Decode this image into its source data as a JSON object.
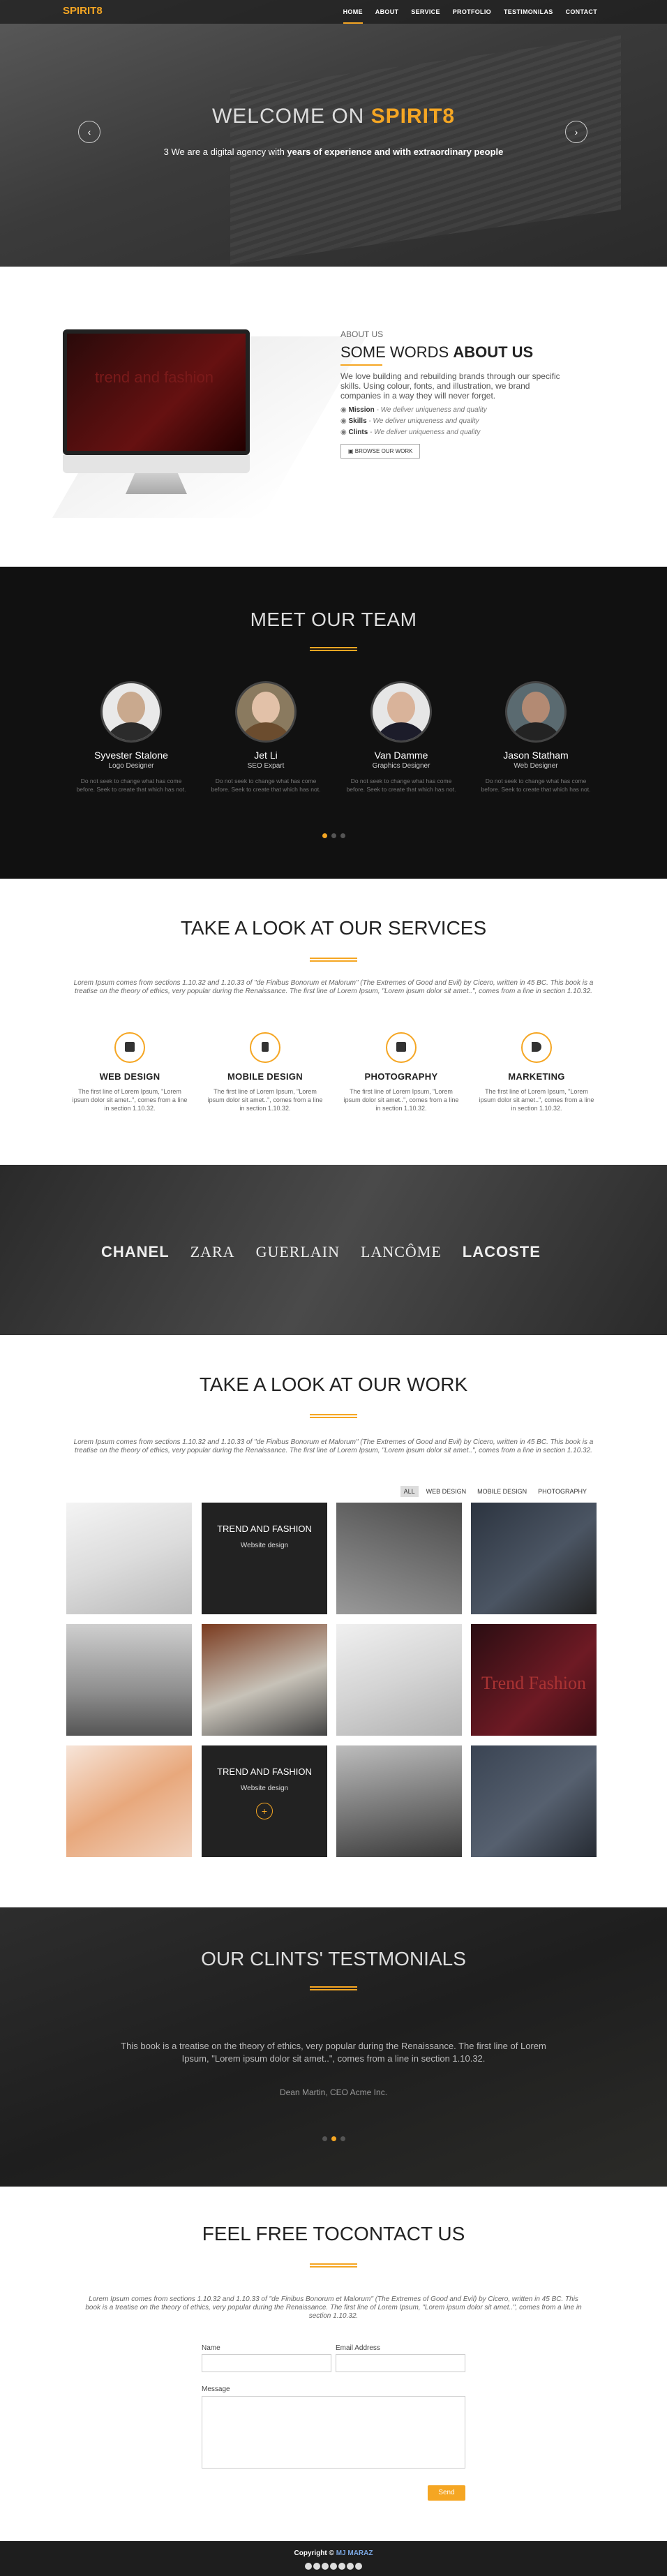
{
  "nav": {
    "logo": "SPIRIT8",
    "items": [
      "HOME",
      "ABOUT",
      "SERVICE",
      "PROTFOLIO",
      "TESTIMONILAS",
      "CONTACT"
    ],
    "active": "HOME"
  },
  "hero": {
    "title_prefix": "WELCOME ON ",
    "title_brand": "SPIRIT8",
    "subtitle_prefix": "3 We are a digital agency with ",
    "subtitle_bold": "years of experience and with extraordinary people",
    "prev": "‹",
    "next": "›"
  },
  "about": {
    "kicker": "ABOUT US",
    "title_prefix": "SOME WORDS ",
    "title_bold": "ABOUT US",
    "lead": "We love building and rebuilding brands through our specific skills. Using colour, fonts, and illustration, we brand companies in a way they will never forget.",
    "items": [
      {
        "name": "Mission",
        "desc": " - We deliver uniqueness and quality"
      },
      {
        "name": "Skills",
        "desc": " - We deliver uniqueness and quality"
      },
      {
        "name": "Clints",
        "desc": " - We deliver uniqueness and quality"
      }
    ],
    "button": "BROWSE OUR WORK",
    "screen_text": "trend and fashion"
  },
  "team": {
    "title": "MEET OUR TEAM",
    "members": [
      {
        "name": "Syvester Stalone",
        "role": "Logo Designer",
        "desc": "Do not seek to change what has come before. Seek to create that which has not."
      },
      {
        "name": "Jet Li",
        "role": "SEO Expart",
        "desc": "Do not seek to change what has come before. Seek to create that which has not."
      },
      {
        "name": "Van Damme",
        "role": "Graphics Designer",
        "desc": "Do not seek to change what has come before. Seek to create that which has not."
      },
      {
        "name": "Jason Statham",
        "role": "Web Designer",
        "desc": "Do not seek to change what has come before. Seek to create that which has not."
      }
    ]
  },
  "services": {
    "title": "TAKE A LOOK AT OUR SERVICES",
    "intro": "Lorem Ipsum comes from sections 1.10.32 and 1.10.33 of \"de Finibus Bonorum et Malorum\" (The Extremes of Good and Evil) by Cicero, written in 45 BC. This book is a treatise on the theory of ethics, very popular during the Renaissance. The first line of Lorem Ipsum, \"Lorem ipsum dolor sit amet..\", comes from a line in section 1.10.32.",
    "items": [
      {
        "title": "WEB DESIGN",
        "desc": "The first line of Lorem Ipsum, \"Lorem ipsum dolor sit amet..\", comes from a line in section 1.10.32.",
        "icon": "monitor-icon"
      },
      {
        "title": "MOBILE DESIGN",
        "desc": "The first line of Lorem Ipsum, \"Lorem ipsum dolor sit amet..\", comes from a line in section 1.10.32.",
        "icon": "mobile-icon"
      },
      {
        "title": "PHOTOGRAPHY",
        "desc": "The first line of Lorem Ipsum, \"Lorem ipsum dolor sit amet..\", comes from a line in section 1.10.32.",
        "icon": "camera-icon"
      },
      {
        "title": "MARKETING",
        "desc": "The first line of Lorem Ipsum, \"Lorem ipsum dolor sit amet..\", comes from a line in section 1.10.32.",
        "icon": "megaphone-icon"
      }
    ]
  },
  "brands": [
    "CHANEL",
    "ZARA",
    "GUERLAIN",
    "LANCÔME",
    "LACOSTE"
  ],
  "work": {
    "title": "TAKE A LOOK AT OUR WORK",
    "intro": "Lorem Ipsum comes from sections 1.10.32 and 1.10.33 of \"de Finibus Bonorum et Malorum\" (The Extremes of Good and Evil) by Cicero, written in 45 BC. This book is a treatise on the theory of ethics, very popular during the Renaissance. The first line of Lorem Ipsum, \"Lorem ipsum dolor sit amet..\", comes from a line in section 1.10.32.",
    "filters": [
      "ALL",
      "WEB DESIGN",
      "MOBILE DESIGN",
      "PHOTOGRAPHY"
    ],
    "active_filter": "ALL",
    "overlay_title": "TREND AND FASHION",
    "overlay_sub": "Website design",
    "overlay_plus": "+",
    "poster_text": "Trend Fashion"
  },
  "testimonials": {
    "title": "OUR CLINTS' TESTMONIALS",
    "quote": "This book is a treatise on the theory of ethics, very popular during the Renaissance. The first line of Lorem Ipsum, \"Lorem ipsum dolor sit amet..\", comes from a line in section 1.10.32.",
    "author": "Dean Martin, CEO Acme Inc."
  },
  "contact": {
    "title": "FEEL FREE TOCONTACT US",
    "intro": "Lorem Ipsum comes from sections 1.10.32 and 1.10.33 of \"de Finibus Bonorum et Malorum\" (The Extremes of Good and Evil) by Cicero, written in 45 BC. This book is a treatise on the theory of ethics, very popular during the Renaissance. The first line of Lorem Ipsum, \"Lorem ipsum dolor sit amet..\", comes from a line in section 1.10.32.",
    "name_label": "Name",
    "email_label": "Email Address",
    "message_label": "Message",
    "send": "Send"
  },
  "footer": {
    "copyright_prefix": "Copyright © ",
    "author": "MJ MARAZ",
    "social": [
      "facebook-icon",
      "dribbble-icon",
      "linkedin-icon",
      "instagram-icon",
      "google-plus-icon",
      "twitter-icon",
      "youtube-icon"
    ]
  },
  "colors": {
    "accent": "#f5a623",
    "dark": "#111111",
    "link": "#7aa6e0"
  }
}
